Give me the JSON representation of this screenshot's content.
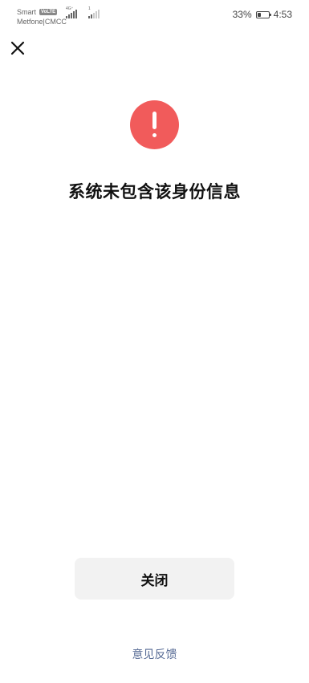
{
  "status_bar": {
    "carrier_1": "Smart",
    "volte_badge": "VoLTE",
    "carrier_2": "Metfone|CMCC",
    "network_type": "4G⁺",
    "sim2_tag": "1",
    "battery_percent": "33%",
    "battery_level": 0.33,
    "time": "4:53"
  },
  "header": {
    "close_icon": "close-icon"
  },
  "alert": {
    "icon": "exclamation-circle-icon",
    "color": "#f15b5b",
    "message": "系统未包含该身份信息"
  },
  "actions": {
    "close_label": "关闭",
    "feedback_label": "意见反馈",
    "feedback_color": "#576b95"
  }
}
